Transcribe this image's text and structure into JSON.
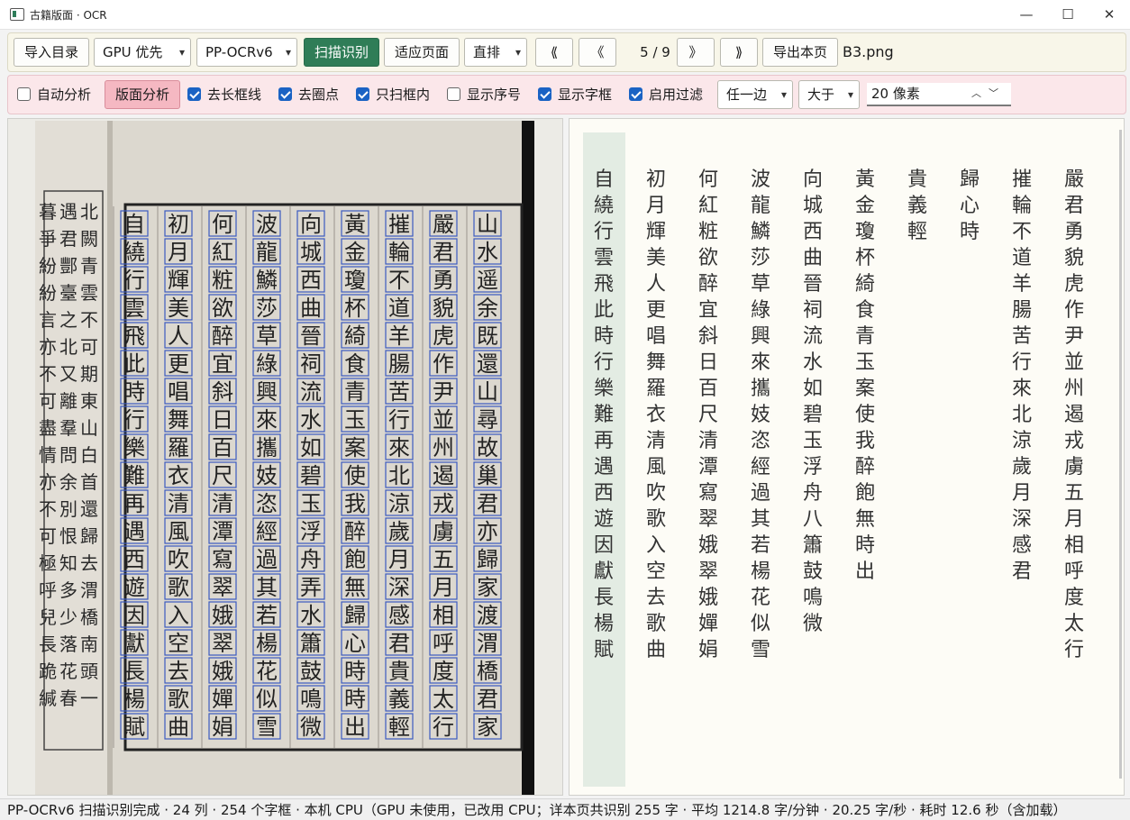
{
  "window": {
    "title": "古籍版面 · OCR",
    "minimize": "—",
    "maximize": "☐",
    "close": "✕"
  },
  "toolbar1": {
    "import_toc": "导入目录",
    "device": "GPU 优先",
    "model": "PP-OCRv6",
    "scan": "扫描识别",
    "fit_page": "适应页面",
    "layout": "直排",
    "first": "⟪",
    "prev": "《",
    "page": "5 / 9",
    "next": "》",
    "last": "⟫",
    "export": "导出本页",
    "filename": "B3.png"
  },
  "toolbar2": {
    "auto_analysis": {
      "label": "自动分析",
      "checked": false
    },
    "layout_analysis": "版面分析",
    "remove_frame": {
      "label": "去长框线",
      "checked": true
    },
    "remove_circles": {
      "label": "去圈点",
      "checked": true
    },
    "scan_inside": {
      "label": "只扫框内",
      "checked": true
    },
    "show_order": {
      "label": "显示序号",
      "checked": false
    },
    "show_boxes": {
      "label": "显示字框",
      "checked": true
    },
    "enable_filter": {
      "label": "启用过滤",
      "checked": true
    },
    "edge": "任一边",
    "compare": "大于",
    "threshold": "20 像素"
  },
  "scan": {
    "columns": [
      "山水遥余既還山尋故巢君亦歸家渡渭橋君家",
      "嚴君勇貌虎作尹並州遏戎虜五月相呼度太行",
      "摧輪不道羊腸苦行來北涼歲月深感君貴義輕",
      "黃金瓊杯綺食青玉案使我醉飽無歸心時時出",
      "向城西曲晉祠流水如碧玉浮舟弄水簫鼓鳴微",
      "波龍鱗莎草綠興來攜妓恣經過其若楊花似雪",
      "何紅粧欲醉宜斜日百尺清潭寫翠娥翠娥嬋娟",
      "初月輝美人更唱舞羅衣清風吹歌入空去歌曲",
      "自繞行雲飛此時行樂難再遇西遊因獻長楊賦"
    ],
    "side_columns": [
      "北闕青雲不可期東山白首還歸去渭橋南頭一",
      "遇君酆臺之北又離羣問余別恨知多少落花春",
      "暮爭紛紛言亦不可盡情亦不可極呼兒長跪緘"
    ]
  },
  "ocr": {
    "columns": [
      "嚴君勇貌虎作尹並州遏戎虜五月相呼度太行",
      "摧輪不道羊腸苦行來北涼歲月深感君",
      "歸心時",
      "貴義輕",
      "黃金瓊杯綺食青玉案使我醉飽無時出",
      "向城西曲晉祠流水如碧玉浮舟八簫鼓鳴微",
      "波龍鱗莎草綠興來攜妓恣經過其若楊花似雪",
      "何紅粧欲醉宜斜日百尺清潭寫翠娥翠娥嬋娟",
      "初月輝美人更唱舞羅衣清風吹歌入空去歌曲",
      "自繞行雲飛此時行樂難再遇西遊因獻長楊賦"
    ]
  },
  "status": "PP-OCRv6 扫描识别完成 · 24 列 · 254 个字框 · 本机 CPU（GPU 未使用，已改用 CPU；详本页共识别 255 字 · 平均 1214.8 字/分钟 · 20.25 字/秒 · 耗时 12.6 秒（含加载）",
  "colors": {
    "box": "#3b5bc0",
    "scan_button": "#2f7d57",
    "toolbar2_bg": "#fbe7ea",
    "highlight_col": "#e3ece3"
  }
}
